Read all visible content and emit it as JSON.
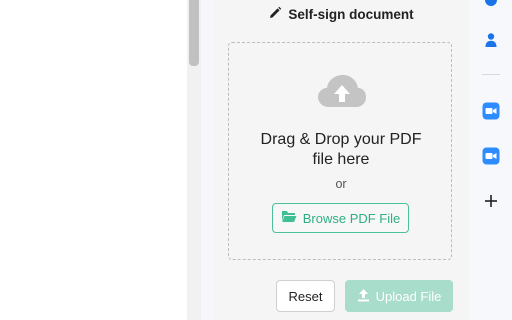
{
  "panel": {
    "title": "Self-sign document",
    "dropzone": {
      "drag_line1": "Drag & Drop your PDF",
      "drag_line2": "file here",
      "or": "or",
      "browse_label": "Browse PDF File"
    },
    "reset_label": "Reset",
    "upload_label": "Upload File"
  },
  "side_bar": {
    "items": [
      {
        "icon": "circle-icon",
        "color": "#1a73e8"
      },
      {
        "icon": "contacts-icon",
        "color": "#1a73e8"
      },
      {
        "icon": "zoom-video-icon",
        "color": "#2d8cff"
      },
      {
        "icon": "zoom-video-icon",
        "color": "#2d8cff"
      },
      {
        "icon": "plus-icon",
        "color": "#222222"
      }
    ]
  },
  "colors": {
    "accent": "#2fae86",
    "upload_disabled": "#a8ddcb"
  }
}
